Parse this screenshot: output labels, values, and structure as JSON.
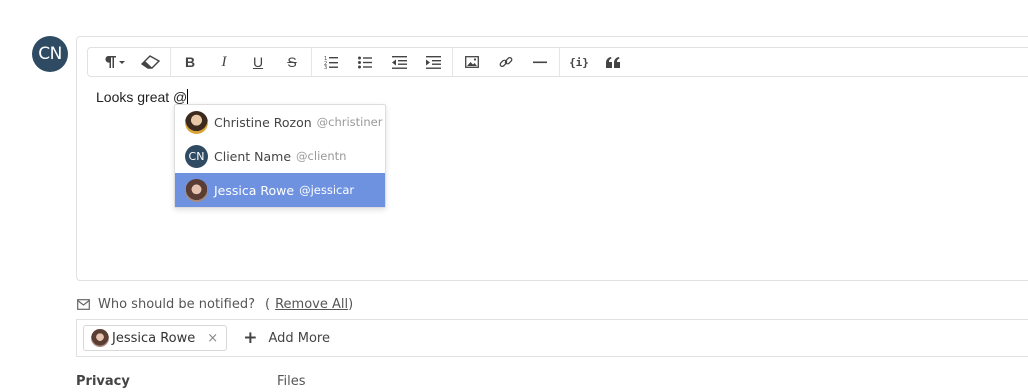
{
  "author_avatar": {
    "initials": "CN",
    "color": "#2f4a63"
  },
  "toolbar": {
    "buttons": [
      {
        "icon": "paragraph-format-icon"
      },
      {
        "icon": "eraser-icon"
      },
      {
        "icon": "bold-icon",
        "text": "B"
      },
      {
        "icon": "italic-icon",
        "text": "I"
      },
      {
        "icon": "underline-icon",
        "text": "U"
      },
      {
        "icon": "strikethrough-icon",
        "text": "S"
      },
      {
        "icon": "ordered-list-icon"
      },
      {
        "icon": "unordered-list-icon"
      },
      {
        "icon": "outdent-icon"
      },
      {
        "icon": "indent-icon"
      },
      {
        "icon": "image-icon"
      },
      {
        "icon": "link-icon"
      },
      {
        "icon": "horizontal-rule-icon"
      },
      {
        "icon": "code-icon",
        "text": "{i}"
      },
      {
        "icon": "quote-icon"
      }
    ]
  },
  "editor": {
    "text": "Looks great @"
  },
  "mention_menu": {
    "items": [
      {
        "name": "Christine Rozon",
        "handle": "@christiner",
        "avatar": "photo",
        "active": false
      },
      {
        "name": "Client Name",
        "handle": "@clientn",
        "avatar": "CN",
        "active": false
      },
      {
        "name": "Jessica Rowe",
        "handle": "@jessicar",
        "avatar": "photo",
        "active": true
      }
    ],
    "active_color": "#6e92e0"
  },
  "notify": {
    "label": "Who should be notified?",
    "open_paren": "(",
    "remove_all": "Remove All",
    "close_paren": ")"
  },
  "recipients": {
    "chips": [
      {
        "name": "Jessica Rowe",
        "remove": "×"
      }
    ],
    "add_more_icon": "+",
    "add_more": "Add More"
  },
  "footer": {
    "privacy_label": "Privacy",
    "files_label": "Files"
  }
}
